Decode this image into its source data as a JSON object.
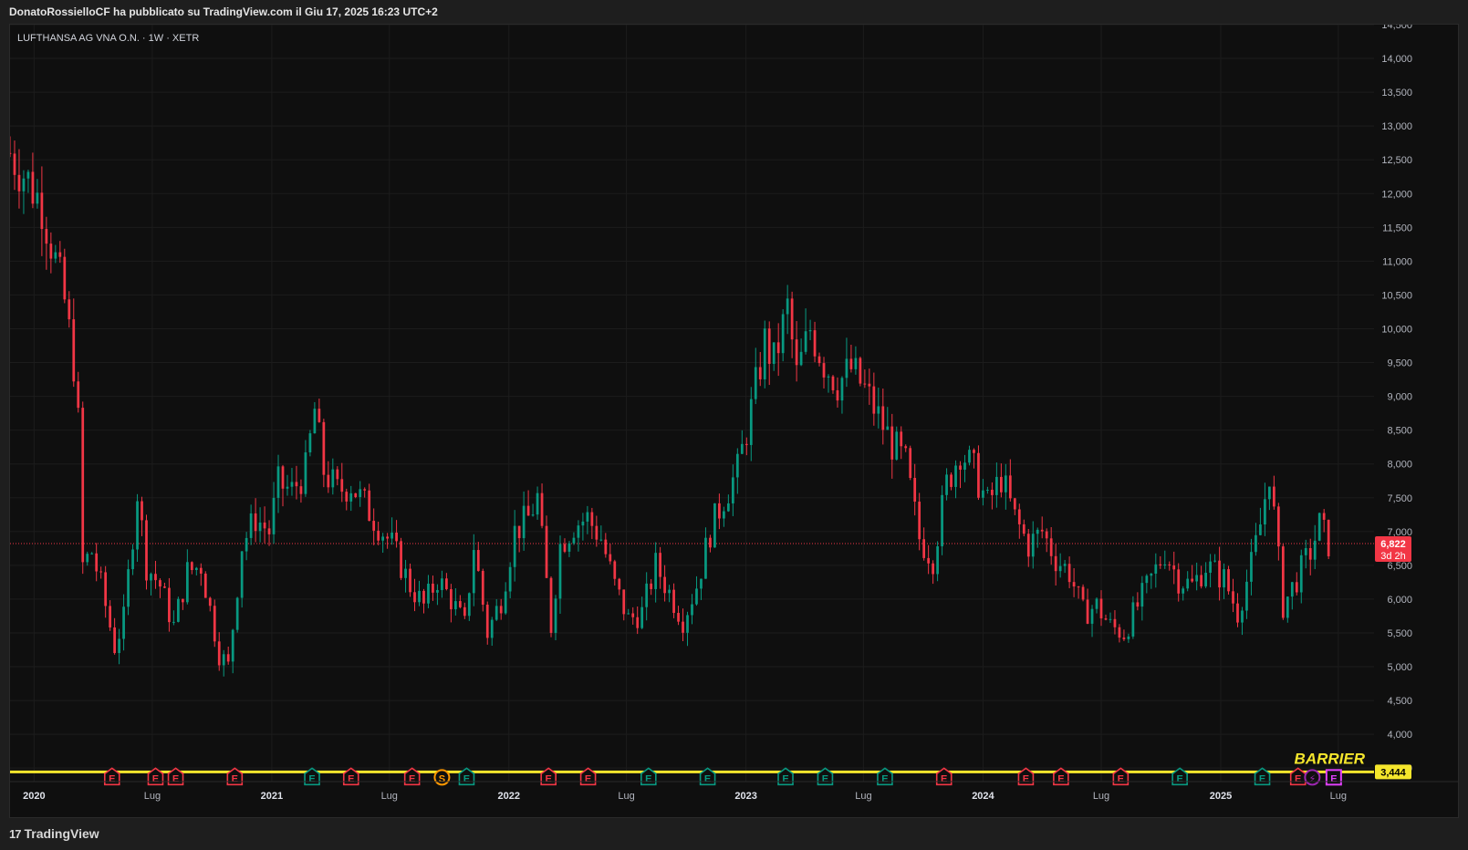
{
  "header": {
    "published_text": "DonatoRossielloCF ha pubblicato su TradingView.com il Giu 17, 2025 16:23 UTC+2"
  },
  "footer": {
    "brand_mark": "17",
    "brand_name": "TradingView"
  },
  "chart_data": {
    "type": "candlestick",
    "symbol_label": "LUFTHANSA AG VNA O.N. · 1W · XETR",
    "timeframe": "1W",
    "exchange": "XETR",
    "y_axis": {
      "range": [
        3300,
        14500
      ],
      "tick_values": [
        3500,
        4000,
        4500,
        5000,
        5500,
        6000,
        6500,
        7000,
        7500,
        8000,
        8500,
        9000,
        9500,
        10000,
        10500,
        11000,
        11500,
        12000,
        12500,
        13000,
        13500,
        14000,
        14500
      ],
      "tick_labels": [
        "3,500",
        "4,000",
        "4,500",
        "5,000",
        "5,500",
        "6,000",
        "6,500",
        "7,000",
        "7,500",
        "8,000",
        "8,500",
        "9,000",
        "9,500",
        "10,000",
        "10,500",
        "11,000",
        "11,500",
        "12,000",
        "12,500",
        "13,000",
        "13,500",
        "14,000",
        "14,500"
      ]
    },
    "x_axis": {
      "range": [
        "2019-11-25",
        "2025-08-25"
      ],
      "ticks": [
        {
          "date": "2020-01-01",
          "label": "2020",
          "bold": true
        },
        {
          "date": "2020-07-01",
          "label": "Lug",
          "bold": false
        },
        {
          "date": "2021-01-01",
          "label": "2021",
          "bold": true
        },
        {
          "date": "2021-07-01",
          "label": "Lug",
          "bold": false
        },
        {
          "date": "2022-01-01",
          "label": "2022",
          "bold": true
        },
        {
          "date": "2022-07-01",
          "label": "Lug",
          "bold": false
        },
        {
          "date": "2023-01-01",
          "label": "2023",
          "bold": true
        },
        {
          "date": "2023-07-01",
          "label": "Lug",
          "bold": false
        },
        {
          "date": "2024-01-01",
          "label": "2024",
          "bold": true
        },
        {
          "date": "2024-07-01",
          "label": "Lug",
          "bold": false
        },
        {
          "date": "2025-01-01",
          "label": "2025",
          "bold": true
        },
        {
          "date": "2025-07-01",
          "label": "Lug",
          "bold": false
        }
      ]
    },
    "close_path": [
      [
        "2019-11-25",
        12600
      ],
      [
        "2019-12-16",
        12300
      ],
      [
        "2020-01-13",
        11850
      ],
      [
        "2020-02-03",
        11000
      ],
      [
        "2020-02-17",
        10400
      ],
      [
        "2020-03-02",
        9500
      ],
      [
        "2020-03-09",
        8600
      ],
      [
        "2020-03-16",
        6500
      ],
      [
        "2020-03-30",
        6700
      ],
      [
        "2020-04-13",
        6200
      ],
      [
        "2020-05-04",
        5300
      ],
      [
        "2020-05-18",
        5700
      ],
      [
        "2020-06-08",
        7600
      ],
      [
        "2020-06-22",
        6500
      ],
      [
        "2020-07-13",
        6200
      ],
      [
        "2020-08-03",
        5600
      ],
      [
        "2020-08-24",
        6400
      ],
      [
        "2020-09-14",
        6500
      ],
      [
        "2020-10-12",
        5200
      ],
      [
        "2020-10-26",
        5000
      ],
      [
        "2020-11-16",
        6800
      ],
      [
        "2020-12-07",
        7200
      ],
      [
        "2020-12-28",
        7000
      ],
      [
        "2021-01-11",
        7700
      ],
      [
        "2021-02-01",
        7600
      ],
      [
        "2021-02-22",
        7900
      ],
      [
        "2021-03-08",
        8800
      ],
      [
        "2021-03-22",
        7900
      ],
      [
        "2021-04-12",
        7600
      ],
      [
        "2021-05-03",
        7700
      ],
      [
        "2021-05-24",
        7400
      ],
      [
        "2021-06-14",
        7100
      ],
      [
        "2021-07-05",
        6800
      ],
      [
        "2021-08-02",
        6200
      ],
      [
        "2021-08-23",
        5900
      ],
      [
        "2021-09-13",
        6300
      ],
      [
        "2021-10-04",
        6000
      ],
      [
        "2021-10-25",
        5600
      ],
      [
        "2021-11-08",
        6800
      ],
      [
        "2021-11-29",
        5500
      ],
      [
        "2021-12-20",
        6000
      ],
      [
        "2022-01-10",
        7000
      ],
      [
        "2022-01-31",
        7200
      ],
      [
        "2022-02-14",
        7500
      ],
      [
        "2022-03-07",
        5600
      ],
      [
        "2022-03-21",
        6800
      ],
      [
        "2022-04-11",
        7100
      ],
      [
        "2022-05-02",
        7200
      ],
      [
        "2022-05-23",
        6900
      ],
      [
        "2022-06-13",
        6200
      ],
      [
        "2022-07-04",
        5700
      ],
      [
        "2022-07-25",
        5800
      ],
      [
        "2022-08-15",
        6500
      ],
      [
        "2022-09-05",
        6100
      ],
      [
        "2022-09-26",
        5700
      ],
      [
        "2022-10-17",
        6200
      ],
      [
        "2022-11-07",
        7000
      ],
      [
        "2022-11-28",
        7500
      ],
      [
        "2022-12-19",
        7900
      ],
      [
        "2023-01-09",
        8800
      ],
      [
        "2023-01-30",
        9800
      ],
      [
        "2023-02-13",
        9500
      ],
      [
        "2023-03-06",
        10300
      ],
      [
        "2023-03-20",
        9300
      ],
      [
        "2023-04-10",
        10000
      ],
      [
        "2023-05-01",
        9500
      ],
      [
        "2023-05-22",
        9200
      ],
      [
        "2023-06-12",
        9400
      ],
      [
        "2023-07-03",
        9100
      ],
      [
        "2023-07-24",
        8700
      ],
      [
        "2023-08-14",
        8300
      ],
      [
        "2023-09-04",
        8000
      ],
      [
        "2023-09-25",
        6900
      ],
      [
        "2023-10-16",
        6600
      ],
      [
        "2023-11-06",
        7700
      ],
      [
        "2023-11-27",
        8200
      ],
      [
        "2023-12-18",
        7900
      ],
      [
        "2024-01-08",
        7400
      ],
      [
        "2024-01-29",
        7800
      ],
      [
        "2024-02-19",
        7200
      ],
      [
        "2024-03-11",
        6800
      ],
      [
        "2024-04-01",
        7000
      ],
      [
        "2024-04-22",
        6600
      ],
      [
        "2024-05-13",
        6400
      ],
      [
        "2024-06-03",
        5800
      ],
      [
        "2024-06-24",
        5900
      ],
      [
        "2024-07-15",
        5600
      ],
      [
        "2024-08-05",
        5500
      ],
      [
        "2024-08-26",
        5900
      ],
      [
        "2024-09-16",
        6300
      ],
      [
        "2024-10-07",
        6700
      ],
      [
        "2024-10-28",
        6300
      ],
      [
        "2024-11-18",
        6200
      ],
      [
        "2024-12-09",
        6500
      ],
      [
        "2025-01-06",
        6300
      ],
      [
        "2025-01-27",
        5800
      ],
      [
        "2025-02-17",
        6500
      ],
      [
        "2025-03-03",
        7100
      ],
      [
        "2025-03-17",
        7900
      ],
      [
        "2025-04-07",
        5900
      ],
      [
        "2025-04-28",
        6300
      ],
      [
        "2025-05-19",
        6700
      ],
      [
        "2025-06-02",
        7100
      ],
      [
        "2025-06-16",
        6822
      ]
    ],
    "candles": {
      "bar": "1W",
      "up_color": "#089981",
      "down_color": "#f23645"
    },
    "last_price": {
      "label": "6,822",
      "value": 6822,
      "countdown": "3d 2h",
      "color": "#f23645"
    },
    "barrier": {
      "label": "BARRIER",
      "value": 3444,
      "price_label": "3,444",
      "color": "#f5e62c"
    },
    "events": [
      {
        "date": "2020-04-30",
        "letter": "E",
        "kind": "down"
      },
      {
        "date": "2020-07-06",
        "letter": "E",
        "kind": "down"
      },
      {
        "date": "2020-08-06",
        "letter": "E",
        "kind": "down"
      },
      {
        "date": "2020-11-05",
        "letter": "E",
        "kind": "down"
      },
      {
        "date": "2021-03-04",
        "letter": "E",
        "kind": "up"
      },
      {
        "date": "2021-05-03",
        "letter": "E",
        "kind": "down"
      },
      {
        "date": "2021-08-05",
        "letter": "E",
        "kind": "down"
      },
      {
        "date": "2021-09-20",
        "letter": "S",
        "kind": "split"
      },
      {
        "date": "2021-10-28",
        "letter": "E",
        "kind": "up"
      },
      {
        "date": "2022-03-03",
        "letter": "E",
        "kind": "down"
      },
      {
        "date": "2022-05-03",
        "letter": "E",
        "kind": "down"
      },
      {
        "date": "2022-08-04",
        "letter": "E",
        "kind": "up"
      },
      {
        "date": "2022-11-03",
        "letter": "E",
        "kind": "up"
      },
      {
        "date": "2023-03-03",
        "letter": "E",
        "kind": "up"
      },
      {
        "date": "2023-05-03",
        "letter": "E",
        "kind": "up"
      },
      {
        "date": "2023-08-03",
        "letter": "E",
        "kind": "up"
      },
      {
        "date": "2023-11-02",
        "letter": "E",
        "kind": "down"
      },
      {
        "date": "2024-03-07",
        "letter": "E",
        "kind": "down"
      },
      {
        "date": "2024-04-30",
        "letter": "E",
        "kind": "down"
      },
      {
        "date": "2024-07-31",
        "letter": "E",
        "kind": "down"
      },
      {
        "date": "2024-10-30",
        "letter": "E",
        "kind": "up"
      },
      {
        "date": "2025-03-06",
        "letter": "E",
        "kind": "up"
      },
      {
        "date": "2025-04-30",
        "letter": "E",
        "kind": "down"
      },
      {
        "date": "2025-05-22",
        "letter": "⚡",
        "kind": "flash"
      },
      {
        "date": "2025-06-24",
        "letter": "E",
        "kind": "future"
      }
    ],
    "grid": true,
    "colors": {
      "background": "#0f0f0f",
      "grid": "#1c1c1c",
      "axis_text": "#b2b5be",
      "label_text": "#d1d4dc",
      "event_down": "#f23645",
      "event_up": "#089981",
      "event_split": "#ff9800",
      "event_flash": "#9c27b0",
      "event_future": "#e040fb"
    }
  }
}
